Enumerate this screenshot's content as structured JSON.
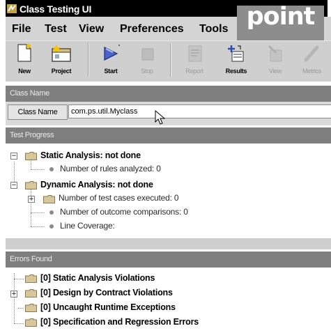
{
  "window": {
    "title": "Class Testing UI"
  },
  "overlay_label": "point",
  "menu": [
    {
      "label": "File"
    },
    {
      "label": "Test"
    },
    {
      "label": "View"
    },
    {
      "label": "Preferences"
    },
    {
      "label": "Tools"
    }
  ],
  "toolbar": [
    {
      "label": "New",
      "icon": "new-document-icon",
      "enabled": true
    },
    {
      "label": "Project",
      "icon": "project-icon",
      "enabled": true
    },
    {
      "label": "Start",
      "icon": "play-icon",
      "enabled": true
    },
    {
      "label": "Stop",
      "icon": "stop-icon",
      "enabled": false
    },
    {
      "label": "Report",
      "icon": "report-icon",
      "enabled": false
    },
    {
      "label": "Results",
      "icon": "results-icon",
      "enabled": true
    },
    {
      "label": "View",
      "icon": "view-icon",
      "enabled": false
    },
    {
      "label": "Metrics",
      "icon": "metrics-icon",
      "enabled": false
    }
  ],
  "class_name_section": {
    "header": "Class Name",
    "label": "Class Name",
    "value": "com.ps.util.Myclass"
  },
  "test_progress": {
    "header": "Test Progress",
    "items": [
      {
        "label": "Static Analysis: not done",
        "bold": true,
        "expander": "−"
      },
      {
        "label": "Number of rules analyzed: 0",
        "bold": false
      },
      {
        "label": "Dynamic Analysis: not done",
        "bold": true,
        "expander": "−"
      },
      {
        "label": "Number of test cases executed: 0",
        "bold": false,
        "expander": "+"
      },
      {
        "label": "Number of outcome comparisons: 0",
        "bold": false
      },
      {
        "label": "Line Coverage:",
        "bold": false
      }
    ]
  },
  "errors_found": {
    "header": "Errors Found",
    "items": [
      {
        "label": "[0]  Static Analysis Violations"
      },
      {
        "label": "[0]  Design by Contract Violations",
        "expander": "+"
      },
      {
        "label": "[0]  Uncaught Runtime Exceptions"
      },
      {
        "label": "[0]  Specification and Regression Errors"
      }
    ]
  },
  "colors": {
    "title_bar": "#000000",
    "section_header": "#7f7f7f",
    "toolbar": "#cfcfcf",
    "folder": "#d8c79a",
    "start_arrow": "#3a4fb0"
  }
}
